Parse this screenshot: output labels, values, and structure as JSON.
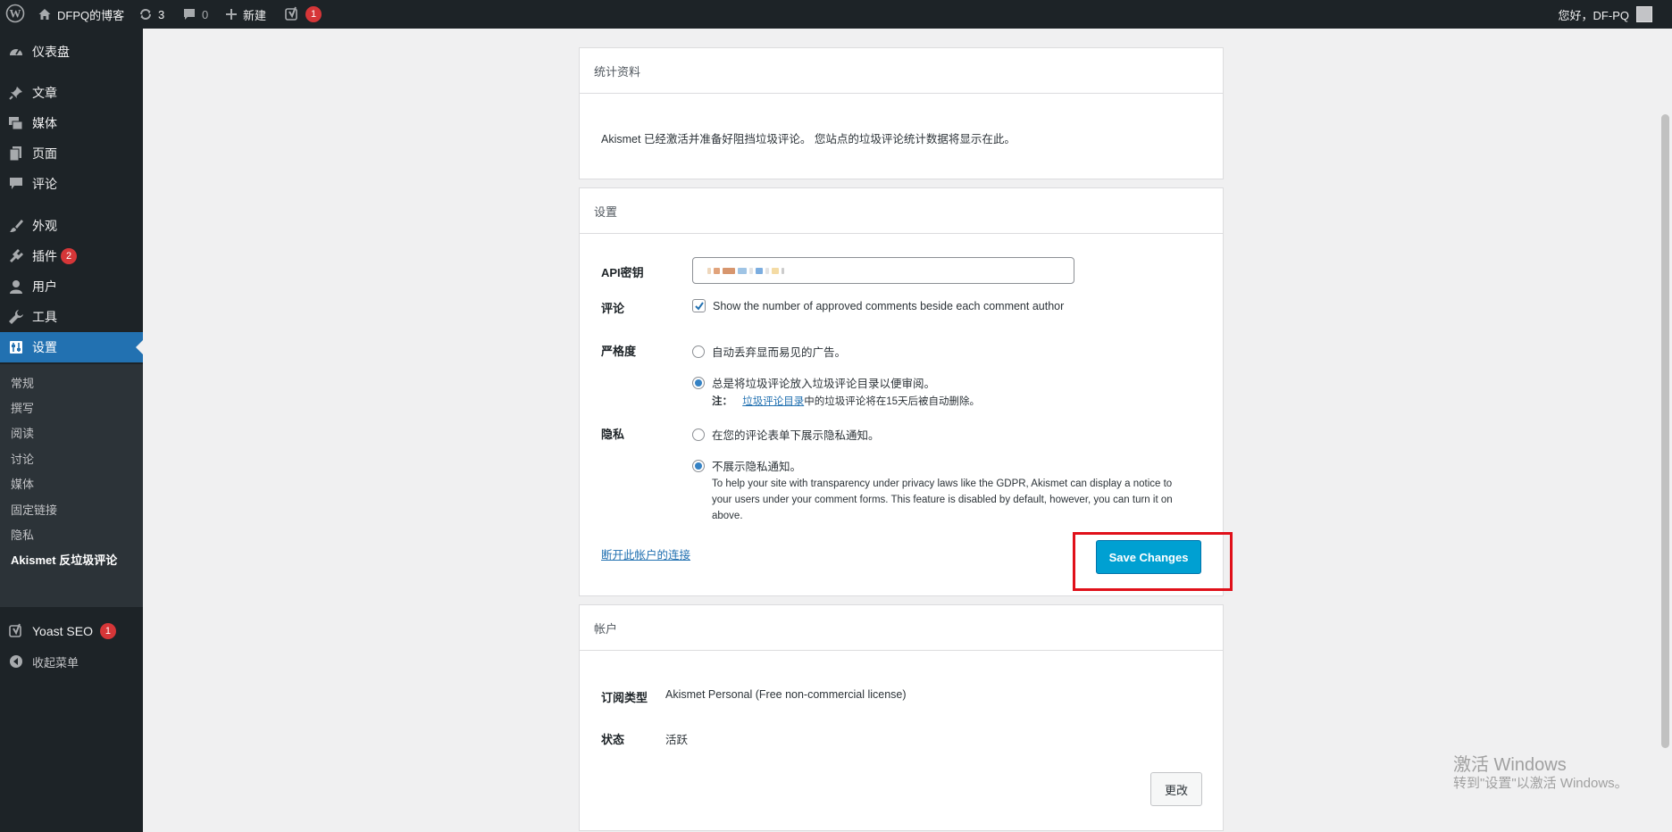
{
  "adminbar": {
    "site_name": "DFPQ的博客",
    "updates_count": "3",
    "comments_count": "0",
    "new_label": "新建",
    "yoast_count": "1",
    "greeting": "您好，DF-PQ"
  },
  "sidebar": {
    "items": [
      {
        "label": "仪表盘",
        "icon": "dashboard-icon"
      },
      {
        "label": "文章",
        "icon": "pin-icon"
      },
      {
        "label": "媒体",
        "icon": "media-icon"
      },
      {
        "label": "页面",
        "icon": "page-icon"
      },
      {
        "label": "评论",
        "icon": "comment-icon"
      },
      {
        "label": "外观",
        "icon": "brush-icon"
      },
      {
        "label": "插件",
        "icon": "plugin-icon",
        "badge": "2"
      },
      {
        "label": "用户",
        "icon": "user-icon"
      },
      {
        "label": "工具",
        "icon": "wrench-icon"
      },
      {
        "label": "设置",
        "icon": "settings-icon"
      }
    ],
    "submenu": [
      "常规",
      "撰写",
      "阅读",
      "讨论",
      "媒体",
      "固定链接",
      "隐私",
      "Akismet 反垃圾评论"
    ],
    "yoast": {
      "label": "Yoast SEO",
      "badge": "1"
    },
    "collapse_label": "收起菜单"
  },
  "stats_panel": {
    "title": "统计资料",
    "message": "Akismet 已经激活并准备好阻挡垃圾评论。 您站点的垃圾评论统计数据将显示在此。"
  },
  "settings_panel": {
    "title": "设置",
    "api_key_label": "API密钥",
    "comments_label": "评论",
    "comments_option": "Show the number of approved comments beside each comment author",
    "comments_checked": true,
    "strictness_label": "严格度",
    "strictness_options": [
      "自动丢弃显而易见的广告。",
      "总是将垃圾评论放入垃圾评论目录以便审阅。"
    ],
    "strictness_selected": 1,
    "note_prefix": "注：",
    "note_link": "垃圾评论目录",
    "note_suffix": "中的垃圾评论将在15天后被自动删除。",
    "privacy_label": "隐私",
    "privacy_options": [
      "在您的评论表单下展示隐私通知。",
      "不展示隐私通知。"
    ],
    "privacy_selected": 1,
    "privacy_help": [
      "To help your site with transparency under privacy laws like the GDPR, Akismet can display a notice to",
      "your users under your comment forms. This feature is disabled by default, however, you can turn it on",
      "above."
    ],
    "disconnect_link": "断开此帐户的连接",
    "save_button": "Save Changes"
  },
  "account_panel": {
    "title": "帐户",
    "subscription_label": "订阅类型",
    "subscription_value": "Akismet Personal (Free non-commercial license)",
    "status_label": "状态",
    "status_value": "活跃",
    "change_button": "更改"
  },
  "watermark": {
    "title": "激活 Windows",
    "subtitle": "转到\"设置\"以激活 Windows。"
  },
  "colors": {
    "accent": "#2271b1",
    "primary_button": "#00a0d2",
    "highlight": "#e0101a",
    "adminbar_bg": "#1d2327"
  }
}
